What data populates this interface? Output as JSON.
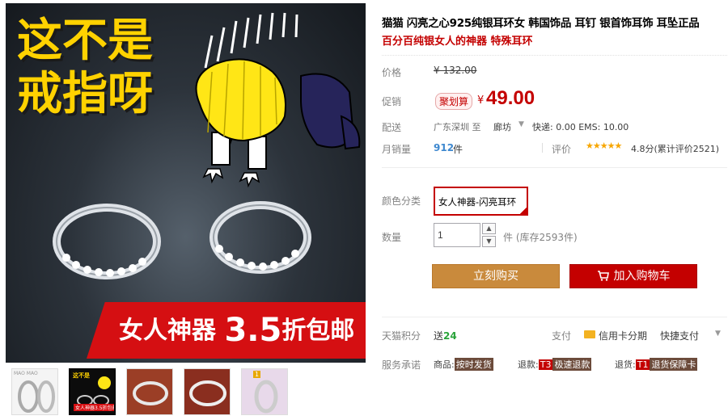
{
  "product": {
    "title": "猫猫 闪亮之心925纯银耳环女 韩国饰品 耳钉 银首饰耳饰 耳坠正品",
    "subtitle": "百分百纯银女人的神器 特殊耳环"
  },
  "image": {
    "headline_line1": "这不是",
    "headline_line2": "戒指呀",
    "promo_prefix": "女人神器 ",
    "promo_number": "3.5",
    "promo_suffix": "折包邮",
    "thumb_brand": "MAO MAO",
    "thumb2_head": "这不是\n戒指呀",
    "thumb2_sale": "女人神器3.5折包邮",
    "thumb5_badge": "1"
  },
  "price": {
    "label": "价格",
    "original": "¥ 132.00",
    "promo_label": "促销",
    "promo_badge": "聚划算",
    "currency": "¥",
    "current": "49.00"
  },
  "shipping": {
    "label": "配送",
    "from": "广东深圳  至",
    "to": "廊坊",
    "caret": "▼",
    "fee": "快递: 0.00 EMS: 10.00"
  },
  "sales": {
    "label": "月销量",
    "count": "912",
    "unit": "件",
    "rating_label": "评价",
    "stars": "★★★★★",
    "score": "4.8分(累计评价2521)"
  },
  "options": {
    "color_label": "颜色分类",
    "color_value": "女人神器-闪亮耳环",
    "qty_label": "数量",
    "qty_value": "1",
    "qty_up": "▲",
    "qty_down": "▼",
    "stock": "件 (库存2593件)"
  },
  "actions": {
    "buy_now": "立刻购买",
    "add_to_cart": "加入购物车"
  },
  "service": {
    "points_label": "天猫积分",
    "points_prefix": "送",
    "points_value": "24",
    "pay_label": "支付",
    "credit": "信用卡分期",
    "fast_pay": "快捷支付",
    "caret": "▼",
    "promise_label": "服务承诺",
    "p1_label": "商品:",
    "p1_tag": "按时发货",
    "p2_label": "退款:",
    "p2_code": "T3",
    "p2_tag": "极速退款",
    "p3_label": "退货:",
    "p3_code": "T1",
    "p3_tag": "退货保障卡"
  },
  "colors": {
    "accent_red": "#c40000",
    "buy_gold": "#c98a3c",
    "sales_blue": "#3e88cf",
    "star_orange": "#f7a600"
  }
}
